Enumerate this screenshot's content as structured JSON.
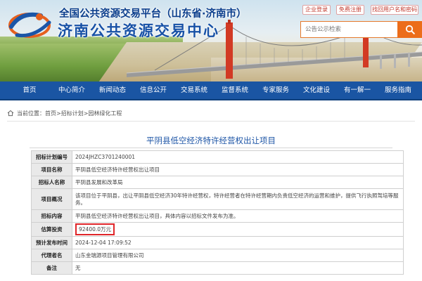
{
  "header": {
    "platform_title": "全国公共资源交易平台（山东省·济南市）",
    "center_name": "济南公共资源交易中心",
    "top_links": [
      "企业登录",
      "免费注册",
      "找回用户名和密码"
    ],
    "search": {
      "placeholder": "公告公示检索"
    }
  },
  "nav": {
    "items": [
      "首页",
      "中心简介",
      "新闻动态",
      "信息公开",
      "交易系统",
      "监督系统",
      "专家服务",
      "文化建设",
      "有一解一",
      "服务指南"
    ]
  },
  "breadcrumb": {
    "label": "当前位置：",
    "path": [
      "首页",
      "招标计划",
      "园林绿化工程"
    ],
    "separator": ">"
  },
  "project": {
    "title": "平阴县低空经济特许经营权出让项目",
    "rows": [
      {
        "label": "招标计划编号",
        "value": "2024JHZC3701240001"
      },
      {
        "label": "项目名称",
        "value": "平阴县低空经济特许经营权出让项目"
      },
      {
        "label": "招标人名称",
        "value": "平阴县发展和改革局"
      },
      {
        "label": "项目概况",
        "value": "该项目位于平阴县，出让平阴县低空经济30年特许经营权，特许经营者在特许经营期内负责低空经济的运营和维护，提供飞行执照驾培等服务。"
      },
      {
        "label": "招标内容",
        "value": "平阴县低空经济特许经营权出让项目，具体内容以招标文件发布为准。"
      },
      {
        "label": "估算投资",
        "value": "92400.0万元"
      },
      {
        "label": "预计发布时间",
        "value": "2024-12-04 17:09:52"
      },
      {
        "label": "代理者名",
        "value": "山东金瑞源项目管理有限公司"
      },
      {
        "label": "备注",
        "value": "无"
      }
    ]
  },
  "colors": {
    "nav_bg": "#1a55a3",
    "search_accent": "#ec6d1a",
    "title_blue": "#1d55a6",
    "highlight_red": "#e0262a"
  },
  "icons": [
    "emblem-logo",
    "search-icon",
    "home-icon"
  ]
}
